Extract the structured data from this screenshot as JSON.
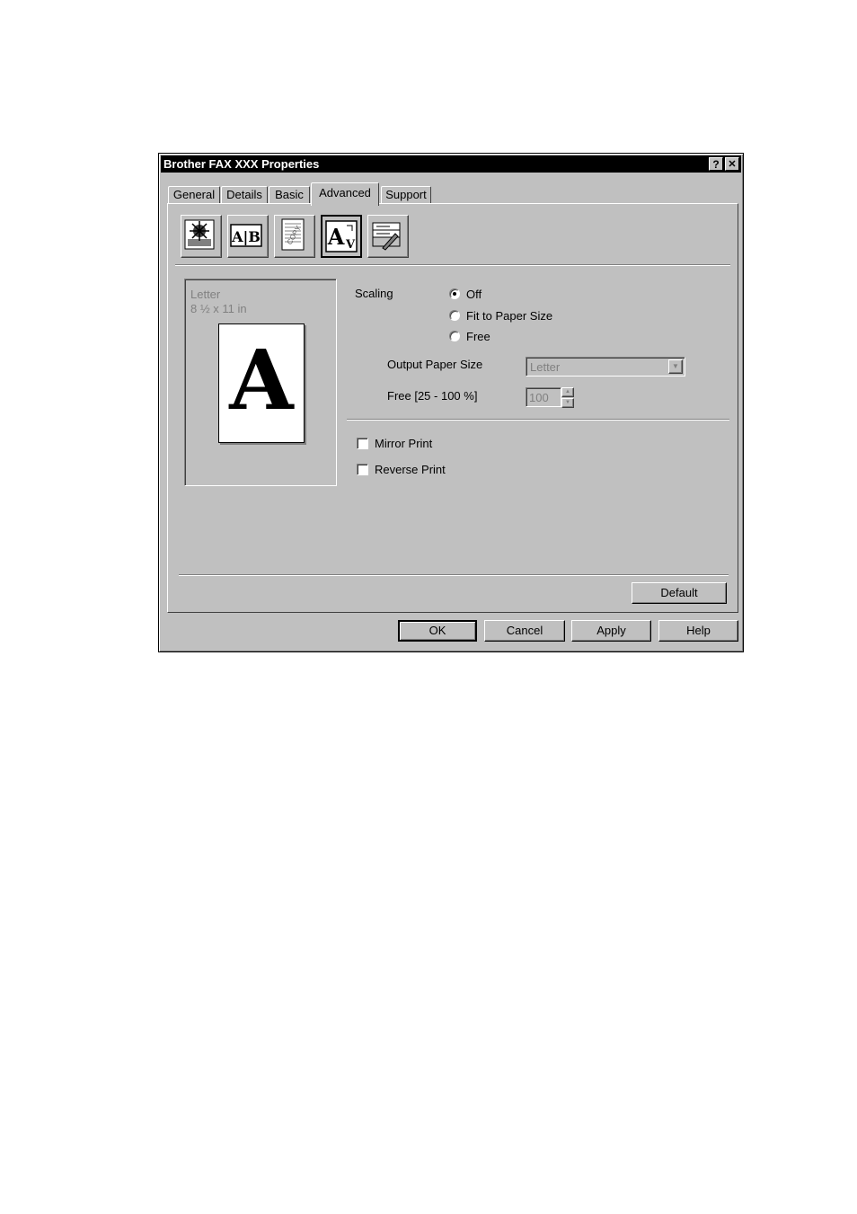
{
  "window": {
    "title": "Brother FAX XXX Properties",
    "help_btn": "?",
    "close_btn": "✕"
  },
  "tabs": [
    {
      "label": "General"
    },
    {
      "label": "Details"
    },
    {
      "label": "Basic"
    },
    {
      "label": "Advanced",
      "active": true
    },
    {
      "label": "Support"
    }
  ],
  "toolbar": {
    "icons": [
      "quality-icon",
      "multiple-page-icon",
      "watermark-icon",
      "scaling-icon",
      "device-options-icon"
    ],
    "ab_text": "A|B",
    "copy_text": "COPY",
    "scale_text_big": "A",
    "scale_text_small": "V"
  },
  "preview": {
    "paper_name": "Letter",
    "paper_dims": "8 ½ x 11 in",
    "glyph": "A"
  },
  "scaling": {
    "label": "Scaling",
    "options": [
      {
        "label": "Off",
        "selected": true
      },
      {
        "label": "Fit to Paper Size",
        "selected": false
      },
      {
        "label": "Free",
        "selected": false
      }
    ],
    "output_paper_size_label": "Output Paper Size",
    "output_paper_size_value": "Letter",
    "free_label": "Free [25 - 100 %]",
    "free_value": "100"
  },
  "options": {
    "mirror_print": {
      "label": "Mirror Print",
      "checked": false
    },
    "reverse_print": {
      "label": "Reverse Print",
      "checked": false
    }
  },
  "buttons": {
    "default": "Default",
    "ok": "OK",
    "cancel": "Cancel",
    "apply": "Apply",
    "help": "Help"
  }
}
